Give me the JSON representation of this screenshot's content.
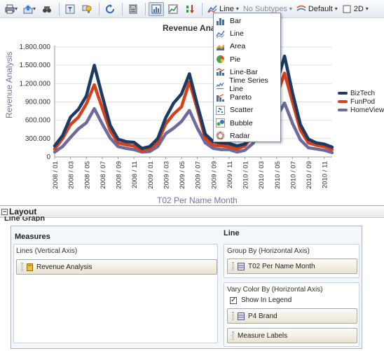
{
  "toolbar": {
    "chart_type": "Line",
    "subtype": "No Subtypes",
    "style": "Default",
    "dimension": "2D"
  },
  "chart_menu": {
    "items": [
      "Bar",
      "Line",
      "Area",
      "Pie",
      "Line-Bar",
      "Time Series Line",
      "Pareto",
      "Scatter",
      "Bubble",
      "Radar"
    ]
  },
  "chart_data": {
    "type": "line",
    "title": "Revenue Analysis",
    "xlabel": "T02 Per Name Month",
    "ylabel": "Revenue Analysis",
    "ylim": [
      0,
      1800000
    ],
    "yticks": [
      "0",
      "300.000",
      "600.000",
      "900.000",
      "1.200.000",
      "1.500.000",
      "1.800.000"
    ],
    "x": [
      "2008 / 01",
      "2008 / 02",
      "2008 / 03",
      "2008 / 04",
      "2008 / 05",
      "2008 / 06",
      "2008 / 07",
      "2008 / 08",
      "2008 / 09",
      "2008 / 10",
      "2008 / 11",
      "2008 / 12",
      "2009 / 01",
      "2009 / 02",
      "2009 / 03",
      "2009 / 04",
      "2009 / 05",
      "2009 / 06",
      "2009 / 07",
      "2009 / 08",
      "2009 / 09",
      "2009 / 10",
      "2009 / 11",
      "2009 / 12",
      "2010 / 01",
      "2010 / 02",
      "2010 / 03",
      "2010 / 04",
      "2010 / 05",
      "2010 / 06",
      "2010 / 07",
      "2010 / 08",
      "2010 / 09",
      "2010 / 10",
      "2010 / 11",
      "2010 / 12"
    ],
    "xtick_labels": [
      "2008 / 01",
      "2008 / 03",
      "2008 / 05",
      "2008 / 07",
      "2008 / 09",
      "2008 / 11",
      "2009 / 01",
      "2009 / 03",
      "2009 / 05",
      "2009 / 07",
      "2009 / 09",
      "2009 / 11",
      "2010 / 01",
      "2010 / 03",
      "2010 / 05",
      "2010 / 07",
      "2010 / 09",
      "2010 / 11"
    ],
    "series": [
      {
        "name": "BizTech",
        "color": "#1c3a63",
        "values": [
          180000,
          350000,
          650000,
          780000,
          1000000,
          1500000,
          1000000,
          520000,
          290000,
          250000,
          240000,
          140000,
          170000,
          300000,
          640000,
          880000,
          1030000,
          1360000,
          850000,
          370000,
          250000,
          230000,
          220000,
          180000,
          210000,
          420000,
          800000,
          1150000,
          1200000,
          1650000,
          1050000,
          530000,
          290000,
          230000,
          210000,
          160000
        ]
      },
      {
        "name": "FunPod",
        "color": "#d8401a",
        "values": [
          130000,
          300000,
          530000,
          650000,
          870000,
          1180000,
          800000,
          430000,
          230000,
          200000,
          180000,
          100000,
          130000,
          240000,
          540000,
          700000,
          820000,
          1230000,
          780000,
          300000,
          190000,
          180000,
          170000,
          130000,
          180000,
          350000,
          680000,
          940000,
          1000000,
          1370000,
          900000,
          440000,
          230000,
          190000,
          170000,
          120000
        ]
      },
      {
        "name": "HomeView",
        "color": "#6e6a9c",
        "values": [
          80000,
          170000,
          320000,
          460000,
          560000,
          790000,
          540000,
          310000,
          170000,
          140000,
          120000,
          80000,
          90000,
          170000,
          380000,
          470000,
          580000,
          760000,
          470000,
          230000,
          140000,
          120000,
          120000,
          80000,
          110000,
          220000,
          440000,
          610000,
          660000,
          880000,
          550000,
          280000,
          150000,
          130000,
          110000,
          70000
        ]
      }
    ],
    "legend": "right",
    "grid": true
  },
  "layout": {
    "header": "Layout",
    "subtitle": "Line Graph",
    "measures_title": "Measures",
    "lines_label": "Lines (Vertical Axis)",
    "lines_measure": "Revenue Analysis",
    "line_title": "Line",
    "group_by_label": "Group By (Horizontal Axis)",
    "group_by_item": "T02 Per Name Month",
    "vary_color_label": "Vary Color By (Horizontal Axis)",
    "show_in_legend": "Show In Legend",
    "vary_item": "P4 Brand",
    "measure_labels": "Measure Labels"
  }
}
